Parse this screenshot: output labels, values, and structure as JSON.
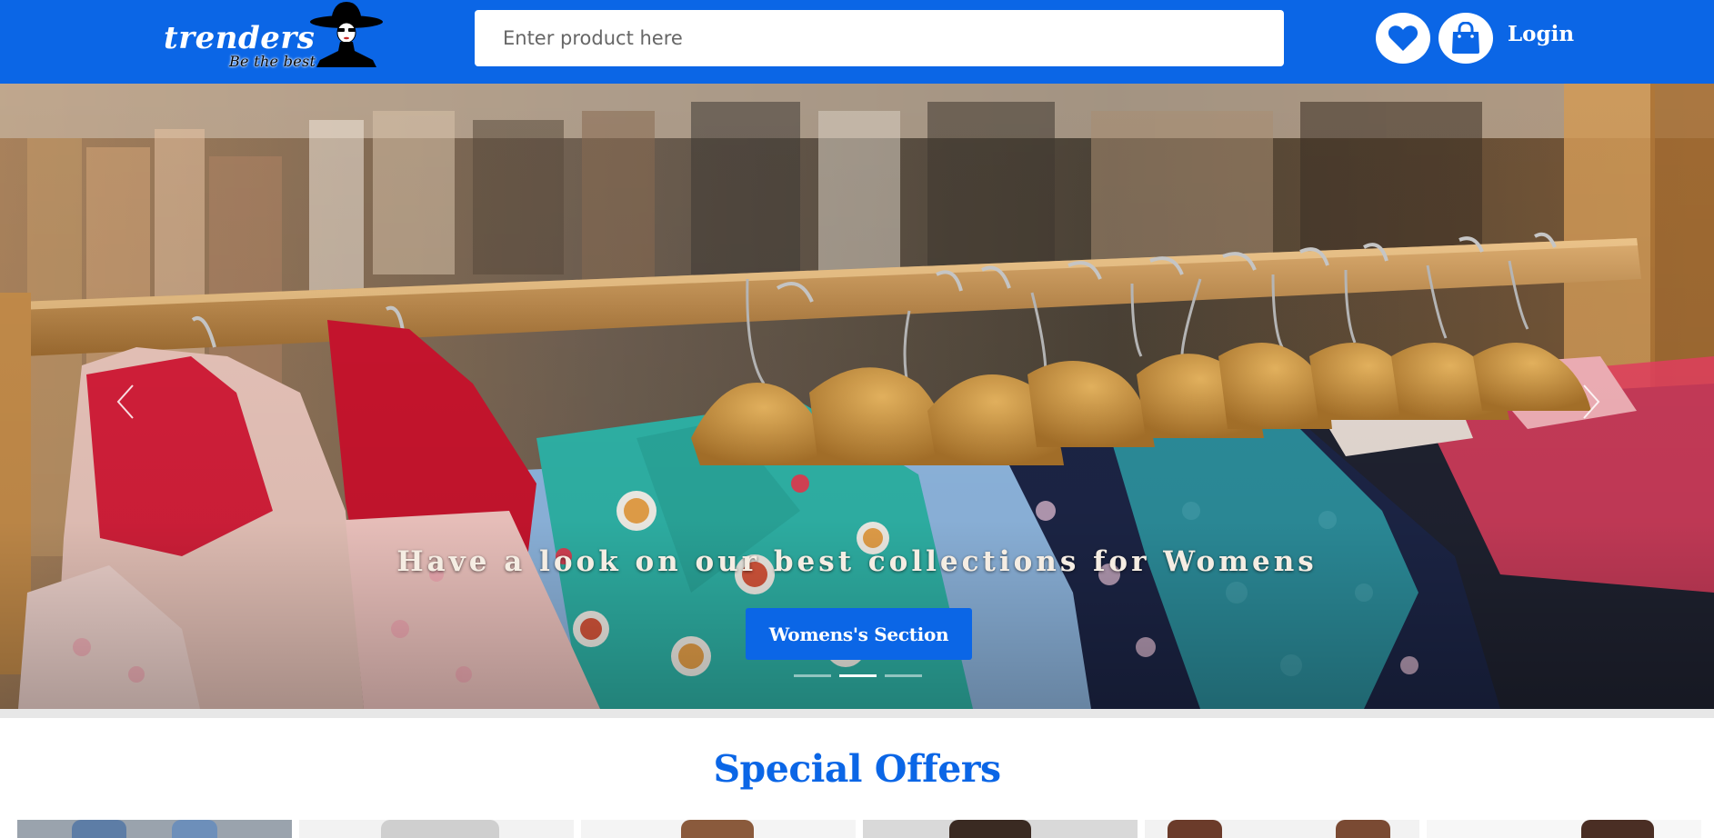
{
  "navbar": {
    "logo_text": "trenders",
    "logo_tagline": "Be the best",
    "search": {
      "placeholder": "Enter product here",
      "value": ""
    },
    "login_label": "Login",
    "colors": {
      "brand": "#0b66e6"
    },
    "icons": [
      "lady-with-hat-logo-icon",
      "heart-icon",
      "shopping-bag-icon"
    ]
  },
  "hero": {
    "caption": "Have a look on our best collections for Womens",
    "button_label": "Womens's Section",
    "slides_count": 3,
    "active_slide": 2,
    "icons": [
      "chevron-left-icon",
      "chevron-right-icon"
    ]
  },
  "special_offers": {
    "title": "Special Offers",
    "cards_visible": 6
  }
}
